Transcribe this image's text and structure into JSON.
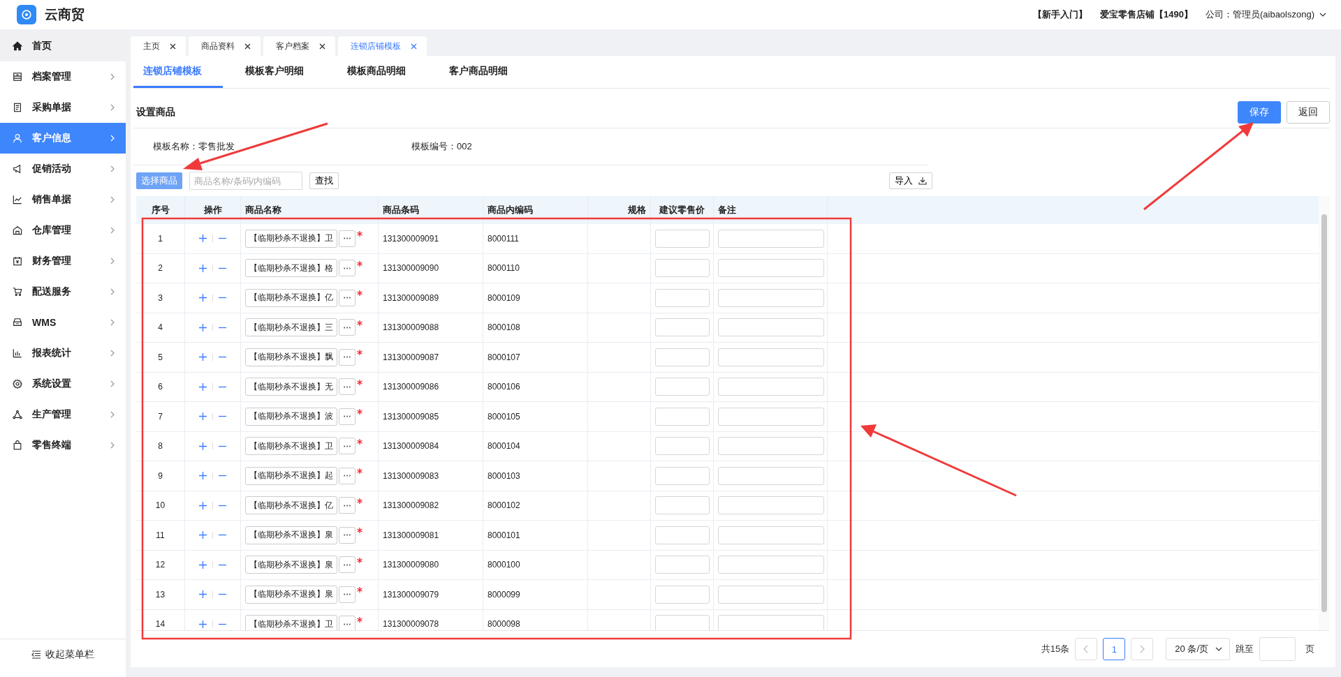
{
  "header": {
    "app_name": "云商贸",
    "links": [
      "【新手入门】",
      "爱宝零售店铺【1490】"
    ],
    "user": "公司：管理员(aibaolszong)"
  },
  "sidebar": {
    "items": [
      {
        "label": "首页",
        "selected": false,
        "hovered": true,
        "expandable": false
      },
      {
        "label": "档案管理",
        "selected": false,
        "hovered": false,
        "expandable": true
      },
      {
        "label": "采购单据",
        "selected": false,
        "hovered": false,
        "expandable": true
      },
      {
        "label": "客户信息",
        "selected": true,
        "hovered": false,
        "expandable": true
      },
      {
        "label": "促销活动",
        "selected": false,
        "hovered": false,
        "expandable": true
      },
      {
        "label": "销售单据",
        "selected": false,
        "hovered": false,
        "expandable": true
      },
      {
        "label": "仓库管理",
        "selected": false,
        "hovered": false,
        "expandable": true
      },
      {
        "label": "财务管理",
        "selected": false,
        "hovered": false,
        "expandable": true
      },
      {
        "label": "配送服务",
        "selected": false,
        "hovered": false,
        "expandable": true
      },
      {
        "label": "WMS",
        "selected": false,
        "hovered": false,
        "expandable": true
      },
      {
        "label": "报表统计",
        "selected": false,
        "hovered": false,
        "expandable": true
      },
      {
        "label": "系统设置",
        "selected": false,
        "hovered": false,
        "expandable": true
      },
      {
        "label": "生产管理",
        "selected": false,
        "hovered": false,
        "expandable": true
      },
      {
        "label": "零售终端",
        "selected": false,
        "hovered": false,
        "expandable": true
      }
    ],
    "collapse": "收起菜单栏"
  },
  "tabs": [
    {
      "label": "主页",
      "selected": false
    },
    {
      "label": "商品资料",
      "selected": false
    },
    {
      "label": "客户档案",
      "selected": false
    },
    {
      "label": "连锁店铺模板",
      "selected": true
    }
  ],
  "subtabs": [
    {
      "label": "连锁店铺模板",
      "selected": true
    },
    {
      "label": "模板客户明细",
      "selected": false
    },
    {
      "label": "模板商品明细",
      "selected": false
    },
    {
      "label": "客户商品明细",
      "selected": false
    }
  ],
  "section_title": "设置商品",
  "actions": [
    {
      "label": "保存",
      "kind": "primary"
    },
    {
      "label": "返回",
      "kind": "default"
    }
  ],
  "info": [
    "模板名称：零售批发",
    "模板编号：002"
  ],
  "toolbar": {
    "select_button": "选择商品",
    "search": {
      "placeholder": "商品名称/条码/内编码"
    },
    "find_button": "查找",
    "import_button": "导入"
  },
  "table": {
    "columns": [
      "序号",
      "操作",
      "商品名称",
      "商品条码",
      "商品内编码",
      "规格",
      "建议零售价",
      "备注"
    ],
    "rows": [
      {
        "no": "1",
        "name": "【临期秒杀不退换】卫",
        "barcode": "131300009091",
        "code": "8000111"
      },
      {
        "no": "2",
        "name": "【临期秒杀不退换】格",
        "barcode": "131300009090",
        "code": "8000110"
      },
      {
        "no": "3",
        "name": "【临期秒杀不退换】亿",
        "barcode": "131300009089",
        "code": "8000109"
      },
      {
        "no": "4",
        "name": "【临期秒杀不退换】三",
        "barcode": "131300009088",
        "code": "8000108"
      },
      {
        "no": "5",
        "name": "【临期秒杀不退换】飘",
        "barcode": "131300009087",
        "code": "8000107"
      },
      {
        "no": "6",
        "name": "【临期秒杀不退换】无",
        "barcode": "131300009086",
        "code": "8000106"
      },
      {
        "no": "7",
        "name": "【临期秒杀不退换】波",
        "barcode": "131300009085",
        "code": "8000105"
      },
      {
        "no": "8",
        "name": "【临期秒杀不退换】卫",
        "barcode": "131300009084",
        "code": "8000104"
      },
      {
        "no": "9",
        "name": "【临期秒杀不退换】起",
        "barcode": "131300009083",
        "code": "8000103"
      },
      {
        "no": "10",
        "name": "【临期秒杀不退换】亿",
        "barcode": "131300009082",
        "code": "8000102"
      },
      {
        "no": "11",
        "name": "【临期秒杀不退换】泉",
        "barcode": "131300009081",
        "code": "8000101"
      },
      {
        "no": "12",
        "name": "【临期秒杀不退换】泉",
        "barcode": "131300009080",
        "code": "8000100"
      },
      {
        "no": "13",
        "name": "【临期秒杀不退换】泉",
        "barcode": "131300009079",
        "code": "8000099"
      },
      {
        "no": "14",
        "name": "【临期秒杀不退换】卫",
        "barcode": "131300009078",
        "code": "8000098"
      }
    ]
  },
  "pagination": {
    "total": "共15条",
    "pages": [
      {
        "label": "1",
        "selected": true
      }
    ],
    "page_size": "20 条/页",
    "jump_label": "跳至",
    "page_unit": "页"
  }
}
